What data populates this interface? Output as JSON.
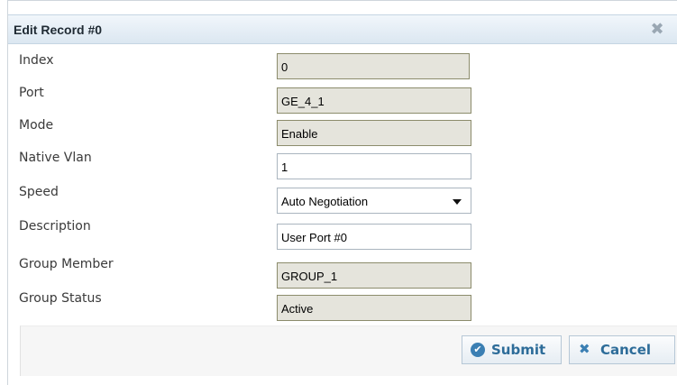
{
  "dialog": {
    "title": "Edit Record #0",
    "close_icon": "close-x-icon"
  },
  "fields": {
    "index": {
      "label": "Index",
      "value": "0"
    },
    "port": {
      "label": "Port",
      "value": "GE_4_1"
    },
    "mode": {
      "label": "Mode",
      "value": "Enable"
    },
    "native_vlan": {
      "label": "Native Vlan",
      "value": "1"
    },
    "speed": {
      "label": "Speed",
      "value": "Auto Negotiation"
    },
    "description": {
      "label": "Description",
      "value": "User Port #0"
    },
    "group_member": {
      "label": "Group Member",
      "value": "GROUP_1"
    },
    "group_status": {
      "label": "Group Status",
      "value": "Active"
    }
  },
  "buttons": {
    "submit": {
      "label": "Submit",
      "icon": "check-circle-icon"
    },
    "cancel": {
      "label": "Cancel",
      "icon": "x-icon"
    }
  },
  "colors": {
    "title_bg": "#dbe7f1",
    "readonly_field_bg": "#e5e4dc",
    "button_text": "#2d6c99"
  }
}
